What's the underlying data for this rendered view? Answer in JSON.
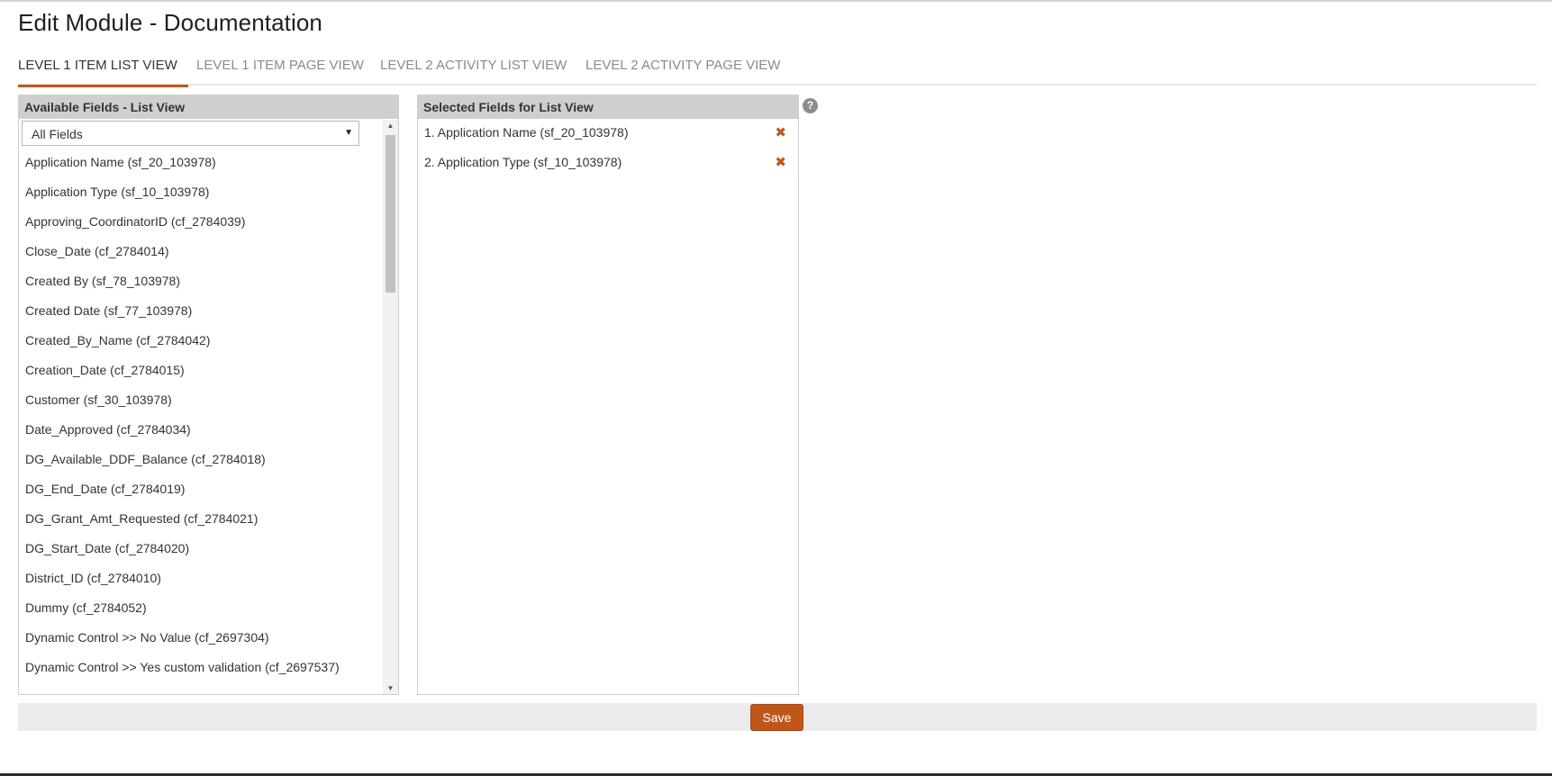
{
  "page": {
    "title": "Edit Module - Documentation"
  },
  "tabs": [
    {
      "label": "LEVEL 1 ITEM LIST VIEW",
      "active": true
    },
    {
      "label": "LEVEL 1 ITEM PAGE VIEW",
      "active": false
    },
    {
      "label": "LEVEL 2 ACTIVITY LIST VIEW",
      "active": false
    },
    {
      "label": "LEVEL 2 ACTIVITY PAGE VIEW",
      "active": false
    }
  ],
  "available": {
    "header": "Available Fields - List View",
    "filter": {
      "selected": "All Fields"
    },
    "fields": [
      "Application Name (sf_20_103978)",
      "Application Type (sf_10_103978)",
      "Approving_CoordinatorID (cf_2784039)",
      "Close_Date (cf_2784014)",
      "Created By (sf_78_103978)",
      "Created Date (sf_77_103978)",
      "Created_By_Name (cf_2784042)",
      "Creation_Date (cf_2784015)",
      "Customer (sf_30_103978)",
      "Date_Approved (cf_2784034)",
      "DG_Available_DDF_Balance (cf_2784018)",
      "DG_End_Date (cf_2784019)",
      "DG_Grant_Amt_Requested (cf_2784021)",
      "DG_Start_Date (cf_2784020)",
      "District_ID (cf_2784010)",
      "Dummy (cf_2784052)",
      "Dynamic Control >> No Value (cf_2697304)",
      "Dynamic Control >> Yes custom validation (cf_2697537)"
    ]
  },
  "selected": {
    "header": "Selected Fields for List View",
    "fields": [
      "1. Application Name (sf_20_103978)",
      "2. Application Type (sf_10_103978)"
    ]
  },
  "icons": {
    "help": "question-circle-icon",
    "remove": "close-x-icon",
    "caret": "caret-down-icon"
  },
  "glyphs": {
    "help": "?",
    "remove": "✖",
    "caret": "▼",
    "scroll_up": "▲",
    "scroll_down": "▼"
  },
  "footer": {
    "save_label": "Save"
  },
  "colors": {
    "accent": "#c0571a",
    "header_bg": "#cfcfcf",
    "footer_bg": "#ececec"
  }
}
